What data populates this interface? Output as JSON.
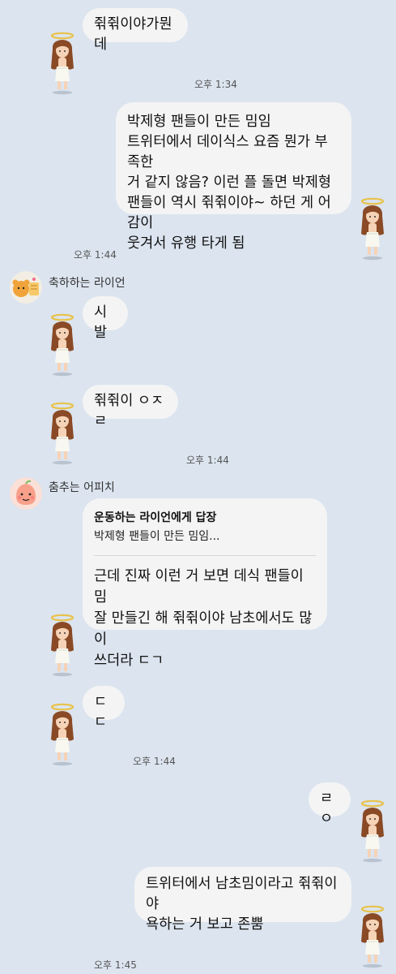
{
  "messages": {
    "m1": "쥒쥒이야가뭔데",
    "m2": "박제형 팬들이 만든 밈임\n트위터에서 데이식스 요즘 뭔가 부족한\n거 같지 않음? 이런 플 돌면 박제형\n팬들이 역시 쥒쥒이야~ 하던 게 어감이\n웃겨서 유행 타게 됨",
    "m3": "시발",
    "m4": "쥒쥒이 ㅇㅈㄹ",
    "m5_reply_title": "운동하는 라이언에게 답장",
    "m5_reply_quote": "박제형 팬들이 만든 밈임...",
    "m5_body": "근데 진짜 이런 거 보면 데식 팬들이 밈\n잘 만들긴 해 쥒쥒이야 남초에서도 많이\n쓰더라 ㄷㄱ",
    "m6": "ㄷㄷ",
    "m7": "ㄹㅇ",
    "m8": "트위터에서 남초밈이라고 쥒쥒이야\n욕하는 거 보고 존뿜"
  },
  "times": {
    "t1": "오후 1:34",
    "t2": "오후 1:44",
    "t3": "오후 1:44",
    "t4": "오후 1:44",
    "t5": "오후 1:45"
  },
  "senders": {
    "ryan": "축하하는 라이언",
    "apeach": "춤추는 어피치"
  },
  "colors": {
    "background": "#dbe4ef",
    "bubble": "#f4f4f4"
  }
}
